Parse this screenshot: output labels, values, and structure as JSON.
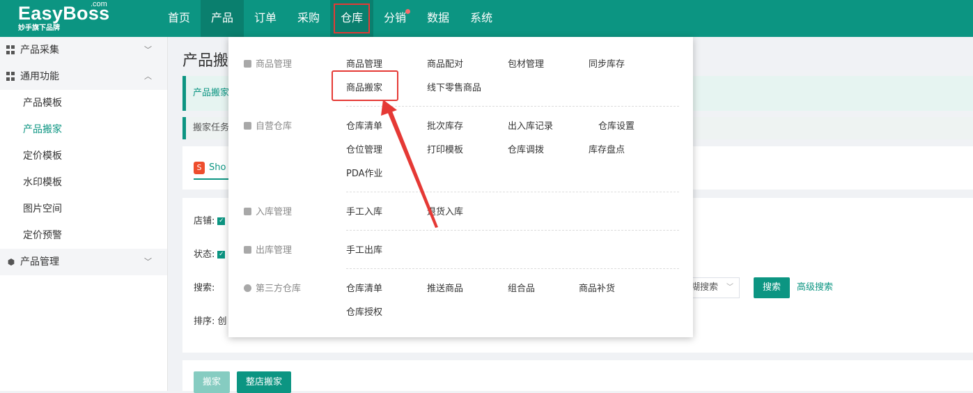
{
  "brand": {
    "name": "EasyBoss",
    "suffix": ".com",
    "tagline": "妙手旗下品牌"
  },
  "nav": [
    "首页",
    "产品",
    "订单",
    "采购",
    "仓库",
    "分销",
    "数据",
    "系统"
  ],
  "sidebar": {
    "group_collect": "产品采集",
    "group_common": "通用功能",
    "items": [
      "产品模板",
      "产品搬家",
      "定价模板",
      "水印模板",
      "图片空间",
      "定价预警"
    ],
    "group_product": "产品管理"
  },
  "main": {
    "title": "产品搬",
    "notice1": "产品搬家",
    "notice2": "搬家任务",
    "tab": "Sho",
    "labels": {
      "store": "店铺:",
      "status": "状态:",
      "search": "搜索:",
      "sort": "排序:",
      "sort_value": "创"
    },
    "search_mode": "糊搜索",
    "search_btn": "搜索",
    "advanced": "高级搜索",
    "move_btn": "搬家",
    "move_store_btn": "整店搬家"
  },
  "dropdown": {
    "cat_goods": "商品管理",
    "goods_items": [
      "商品管理",
      "商品配对",
      "包材管理",
      "同步库存",
      "商品搬家",
      "线下零售商品"
    ],
    "cat_self": "自营仓库",
    "self_items": [
      "仓库清单",
      "批次库存",
      "出入库记录",
      "仓库设置",
      "仓位管理",
      "打印模板",
      "仓库调拨",
      "库存盘点",
      "PDA作业"
    ],
    "cat_in": "入库管理",
    "in_items": [
      "手工入库",
      "退货入库"
    ],
    "cat_out": "出库管理",
    "out_items": [
      "手工出库"
    ],
    "cat_third": "第三方仓库",
    "third_items": [
      "仓库清单",
      "推送商品",
      "组合品",
      "商品补货",
      "仓库授权"
    ]
  },
  "colors": {
    "brand": "#0c9582",
    "annotation": "#e53935"
  }
}
